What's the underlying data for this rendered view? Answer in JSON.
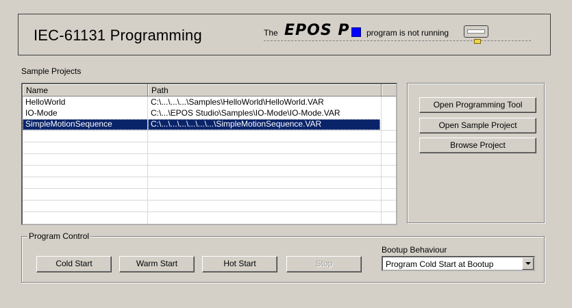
{
  "header": {
    "title": "IEC-61131 Programming",
    "status_prefix": "The",
    "brand": "EPOS P",
    "status_text": "program is not running",
    "status_color": "#0000ff"
  },
  "sample_projects": {
    "label": "Sample Projects",
    "columns": [
      "Name",
      "Path"
    ],
    "rows": [
      {
        "name": "HelloWorld",
        "path": "C:\\...\\...\\...\\Samples\\HelloWorld\\HelloWorld.VAR"
      },
      {
        "name": "IO-Mode",
        "path": "C:\\...\\EPOS Studio\\Samples\\IO-Mode\\IO-Mode.VAR"
      },
      {
        "name": "SimpleMotionSequence",
        "path": "C:\\...\\...\\...\\...\\...\\...\\SimpleMotionSequence.VAR"
      }
    ],
    "selected_index": 2
  },
  "actions": {
    "open_tool": "Open Programming Tool",
    "open_sample": "Open Sample Project",
    "browse": "Browse Project"
  },
  "program_control": {
    "label": "Program Control",
    "cold_start": "Cold Start",
    "warm_start": "Warm Start",
    "hot_start": "Hot Start",
    "stop": "Stop"
  },
  "bootup": {
    "label": "Bootup Behaviour",
    "selected": "Program Cold Start at Bootup"
  },
  "colors": {
    "window_bg": "#d4d0c8",
    "selection": "#0a246a"
  }
}
